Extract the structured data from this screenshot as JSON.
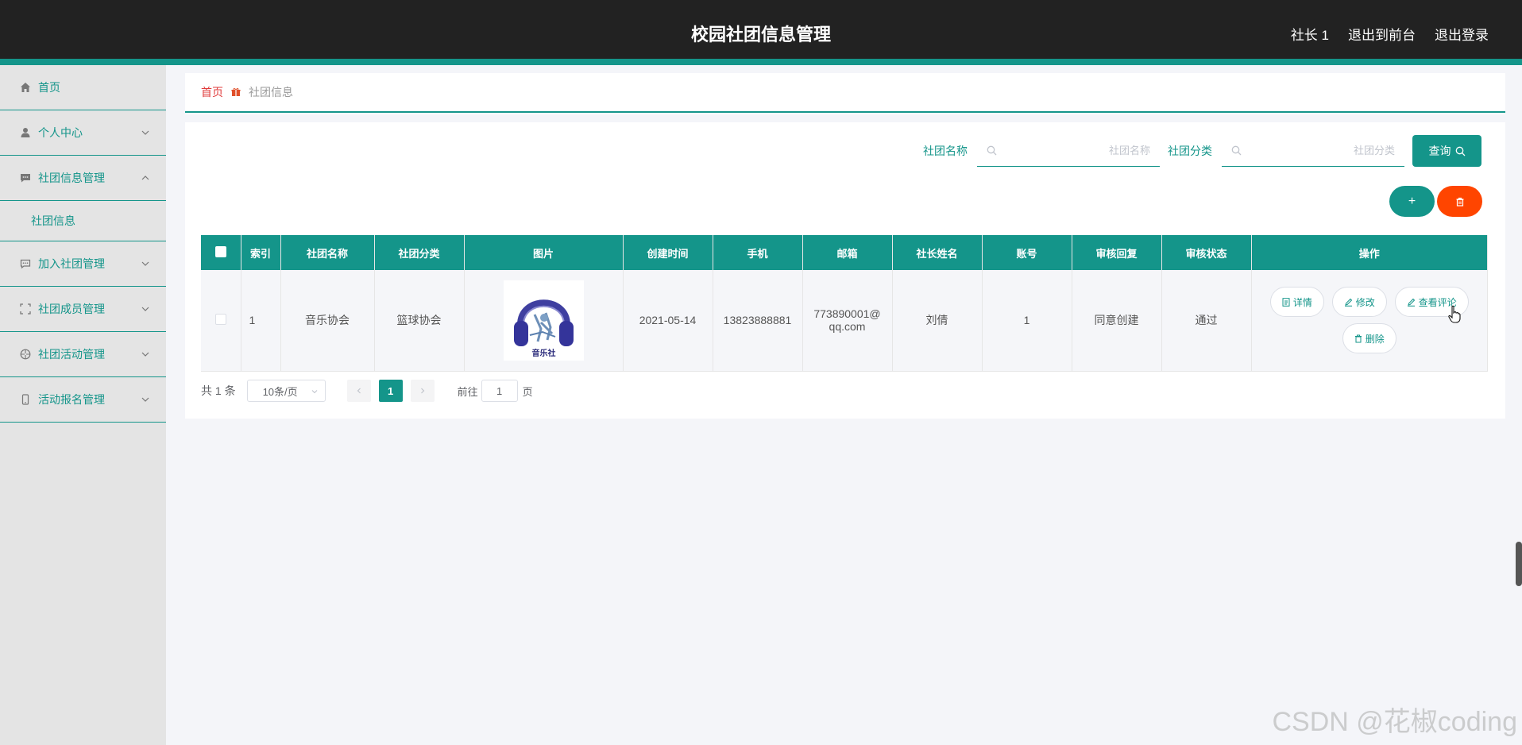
{
  "header": {
    "title": "校园社团信息管理",
    "links": [
      "社长 1",
      "退出到前台",
      "退出登录"
    ]
  },
  "sidebar": {
    "items": [
      {
        "label": "首页",
        "icon": "home-icon"
      },
      {
        "label": "个人中心",
        "icon": "user-icon"
      },
      {
        "label": "社团信息管理",
        "icon": "chat-icon",
        "expanded": true
      },
      {
        "label": "加入社团管理",
        "icon": "message-icon"
      },
      {
        "label": "社团成员管理",
        "icon": "frame-icon"
      },
      {
        "label": "社团活动管理",
        "icon": "aperture-icon"
      },
      {
        "label": "活动报名管理",
        "icon": "mobile-icon"
      }
    ],
    "submenu": {
      "label": "社团信息"
    }
  },
  "breadcrumb": {
    "home": "首页",
    "current": "社团信息"
  },
  "search": {
    "name_label": "社团名称",
    "name_placeholder": "社团名称",
    "category_label": "社团分类",
    "category_placeholder": "社团分类",
    "query_label": "查询"
  },
  "actions": {
    "add": "+"
  },
  "table": {
    "columns": [
      "索引",
      "社团名称",
      "社团分类",
      "图片",
      "创建时间",
      "手机",
      "邮箱",
      "社长姓名",
      "账号",
      "审核回复",
      "审核状态",
      "操作"
    ],
    "rows": [
      {
        "index": "1",
        "name": "音乐协会",
        "category": "篮球协会",
        "image_caption": "音乐社",
        "created": "2021-05-14",
        "phone": "13823888881",
        "email_line1": "773890001@",
        "email_line2": "qq.com",
        "leader": "刘倩",
        "account": "1",
        "reply": "同意创建",
        "status": "通过"
      }
    ],
    "row_actions": [
      "详情",
      "修改",
      "查看评论",
      "删除"
    ]
  },
  "pagination": {
    "total": "共 1 条",
    "page_size": "10条/页",
    "current_page": "1",
    "goto_label": "前往",
    "goto_value": "1",
    "goto_unit": "页"
  },
  "watermark": "CSDN @花椒coding",
  "colors": {
    "primary": "#14958a",
    "danger": "#ff4500",
    "header_bg": "#222222"
  }
}
